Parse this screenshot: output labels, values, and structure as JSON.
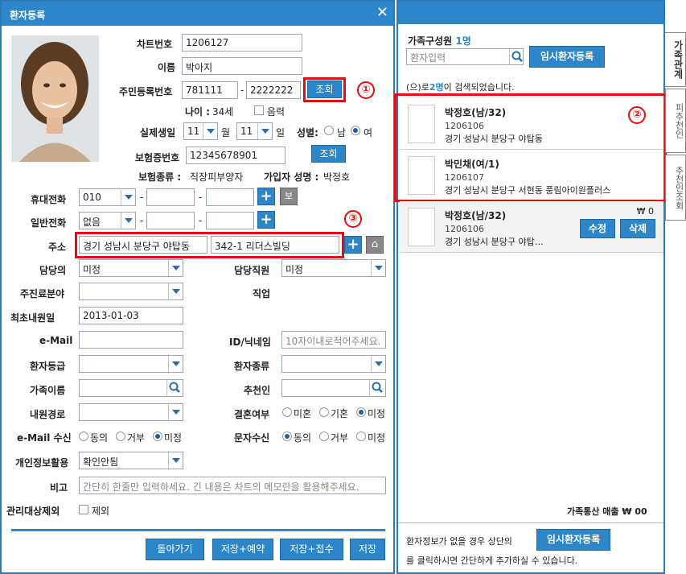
{
  "window": {
    "title": "환자등록"
  },
  "photo_alt": "patient-photo",
  "fields": {
    "chart_no_label": "차트번호",
    "chart_no": "1206127",
    "name_label": "이름",
    "name": "박아지",
    "rrn_label": "주민등록번호",
    "rrn1": "781111",
    "rrn_dash": "-",
    "rrn2": "2222222",
    "rrn_btn": "조회",
    "age_label": "나이 :",
    "age": "34세",
    "lunar_label": "음력",
    "birth_label": "실제생일",
    "birth_month": "11",
    "month_unit": "월",
    "birth_day": "11",
    "day_unit": "일",
    "gender_label": "성별:",
    "male": "남",
    "female": "여",
    "insurance_no_label": "보험증번호",
    "insurance_no": "12345678901",
    "insurance_btn": "조회",
    "insurance_type_label": "보험종류 :",
    "insurance_type": "직장피부양자",
    "subscriber_label": "가입자 성명 :",
    "subscriber": "박정호",
    "mobile_label": "휴대전화",
    "mobile_prefix": "010",
    "dash": "-",
    "mobile_btn": "보",
    "phone_label": "일반전화",
    "phone_prefix": "없음",
    "address_label": "주소",
    "address1": "경기 성남시 분당구 야탑동",
    "address2": "342-1 리더스빌딩",
    "doctor_label": "담당의",
    "doctor": "미정",
    "staff_label": "담당직원",
    "staff": "미정",
    "specialty_label": "주진료분야",
    "job_label": "직업",
    "first_visit_label": "최초내원일",
    "first_visit": "2013-01-03",
    "email_label": "e-Mail",
    "nick_label": "ID/닉네임",
    "nick_placeholder": "10자이내로적어주세요.",
    "grade_label": "환자등급",
    "ptype_label": "환자종류",
    "family_label": "가족이름",
    "referrer_label": "추천인",
    "route_label": "내원경로",
    "married_label": "결혼여부",
    "single": "미혼",
    "married": "기혼",
    "undecided": "미정",
    "email_recv_label": "e-Mail 수신",
    "agree": "동의",
    "refuse": "거부",
    "email_undecided": "미정",
    "sms_label": "문자수신",
    "sms_agree": "동의",
    "sms_refuse": "거부",
    "sms_undecided": "미정",
    "privacy_label": "개인정보활용",
    "privacy": "확인안됨",
    "memo_label": "비고",
    "memo_placeholder": "간단히 한줄만 입력하세요. 긴 내용은 차트의 메모란을 활용해주세요.",
    "exclude_label": "관리대상제외",
    "exclude_check": "제외"
  },
  "buttons": {
    "back": "돌아가기",
    "save_reserve": "저장+예약",
    "save_receive": "저장+접수",
    "save": "저장"
  },
  "markers": {
    "m1": "①",
    "m2": "②",
    "m3": "③"
  },
  "family": {
    "title": "가족구성원",
    "count": "1명",
    "search_placeholder": "환자입력",
    "temp_btn": "임시환자등록",
    "result_prefix": "(으)로",
    "result_count": "2명",
    "result_suffix": "이 검색되었습니다.",
    "results": [
      {
        "name": "박정호(남/32)",
        "id": "1206106",
        "addr": "경기 성남시 분당구 야탑동"
      },
      {
        "name": "박민채(여/1)",
        "id": "1206107",
        "addr": "경기 성남시 분당구 서현동 풍림아이원플러스"
      }
    ],
    "member": {
      "name": "박정호(남/32)",
      "id": "1206106",
      "addr": "경기 성남시 분당구 야탑…",
      "amount": "₩ 0",
      "edit": "수정",
      "delete": "삭제"
    },
    "sales_label": "가족통산 매출",
    "sales": "₩ 00",
    "footer_text1": "환자정보가 없을 경우 상단의",
    "footer_btn": "임시환자등록",
    "footer_text2": "를 클릭하시면 간단하게 추가하실 수 있습니다."
  },
  "tabs": [
    "가족관계",
    "피추천인",
    "추천인조회"
  ],
  "colors": {
    "accent": "#2d86c9",
    "highlight": "#e01010"
  }
}
